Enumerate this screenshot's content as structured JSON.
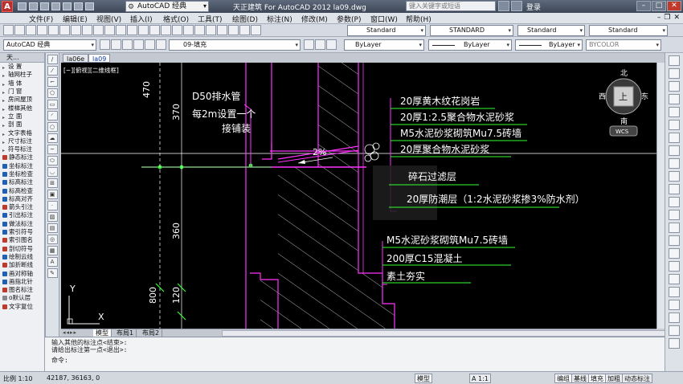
{
  "titlebar": {
    "logo": "A",
    "workspace": "AutoCAD 经典",
    "title": "天正建筑 For AutoCAD 2012    la09.dwg",
    "search_placeholder": "键入关键字或短语",
    "login": "登录",
    "controls": [
      "–",
      "□",
      "✕"
    ]
  },
  "menu": {
    "items": [
      "文件(F)",
      "编辑(E)",
      "视图(V)",
      "插入(I)",
      "格式(O)",
      "工具(T)",
      "绘图(D)",
      "标注(N)",
      "修改(M)",
      "参数(P)",
      "窗口(W)",
      "帮助(H)"
    ],
    "mdi_controls": [
      "–",
      "❐",
      "✕"
    ]
  },
  "toolbar1": {
    "text_style": "Standard",
    "dim_style": "STANDARD",
    "table_style": "Standard",
    "mleader_style": "Standard"
  },
  "toolbar2": {
    "workspace": "AutoCAD 经典",
    "layer": "09-填充",
    "color": "ByLayer",
    "linetype": "ByLayer",
    "lineweight": "ByLayer",
    "plotstyle": "BYCOLOR"
  },
  "doc_tabs": [
    "la06e",
    "la09"
  ],
  "viewport_label": "[−][俯视][二维线框]",
  "left_panel": {
    "title": "天...",
    "items": [
      {
        "label": "设  置",
        "icon": "a"
      },
      {
        "label": "轴网柱子",
        "icon": "a"
      },
      {
        "label": "墙  体",
        "icon": "a"
      },
      {
        "label": "门  窗",
        "icon": "a"
      },
      {
        "label": "房间屋顶",
        "icon": "a"
      },
      {
        "label": "楼梯其他",
        "icon": "a"
      },
      {
        "label": "立  面",
        "icon": "a"
      },
      {
        "label": "剖  面",
        "icon": "a"
      },
      {
        "label": "文字表格",
        "icon": "a"
      },
      {
        "label": "尺寸标注",
        "icon": "a"
      },
      {
        "label": "符号标注",
        "icon": "a"
      },
      {
        "label": "静态标注",
        "icon": "r"
      },
      {
        "label": "坐标标注",
        "icon": "b"
      },
      {
        "label": "坐标检查",
        "icon": "b"
      },
      {
        "label": "标高标注",
        "icon": "b"
      },
      {
        "label": "标高检查",
        "icon": "b"
      },
      {
        "label": "标高对齐",
        "icon": "b"
      },
      {
        "label": "箭头引注",
        "icon": "r"
      },
      {
        "label": "引出标注",
        "icon": "b"
      },
      {
        "label": "做法标注",
        "icon": "b"
      },
      {
        "label": "索引符号",
        "icon": "b"
      },
      {
        "label": "索引图名",
        "icon": "r"
      },
      {
        "label": "剖切符号",
        "icon": "r"
      },
      {
        "label": "绘制云线",
        "icon": "b"
      },
      {
        "label": "加折断线",
        "icon": "r"
      },
      {
        "label": "画对称轴",
        "icon": "b"
      },
      {
        "label": "画指北针",
        "icon": "b"
      },
      {
        "label": "图名标注",
        "icon": "r"
      },
      {
        "label": "o默认层",
        "icon": "g"
      },
      {
        "label": "文字复位",
        "icon": "r"
      }
    ]
  },
  "drawing": {
    "dims": [
      "470",
      "370",
      "360",
      "800",
      "120"
    ],
    "annotations": [
      "D50排水管",
      "每2m设置一个",
      "接铺装",
      "2%",
      "20厚黄木纹花岗岩",
      "20厚1:2.5聚合物水泥砂浆",
      "M5水泥砂浆砌筑Mu7.5砖墙",
      "20厚聚合物水泥砂浆",
      "碎石过滤层",
      "20厚防潮层（1:2水泥砂浆掺3%防水剂）",
      "M5水泥砂浆砌筑Mu7.5砖墙",
      "200厚C15混凝土",
      "素土夯实"
    ],
    "ucs": {
      "y": "Y",
      "x": "X"
    }
  },
  "viewcube": {
    "north": "北",
    "south": "南",
    "east": "东",
    "west": "西",
    "top": "上",
    "wcs": "WCS"
  },
  "layout_tabs": [
    "模型",
    "布局1",
    "布局2"
  ],
  "command": {
    "lines": [
      "输入其他的标注点<结束>:",
      "请给出标注第一点<退出>:"
    ],
    "prompt": "命令:"
  },
  "status": {
    "scale": "比例 1:10",
    "coords": "42187, 36163, 0",
    "model": "模型",
    "annot_scale": "A 1:1",
    "toggles": [
      "编组",
      "基线",
      "填充",
      "加粗",
      "动态标注"
    ]
  }
}
